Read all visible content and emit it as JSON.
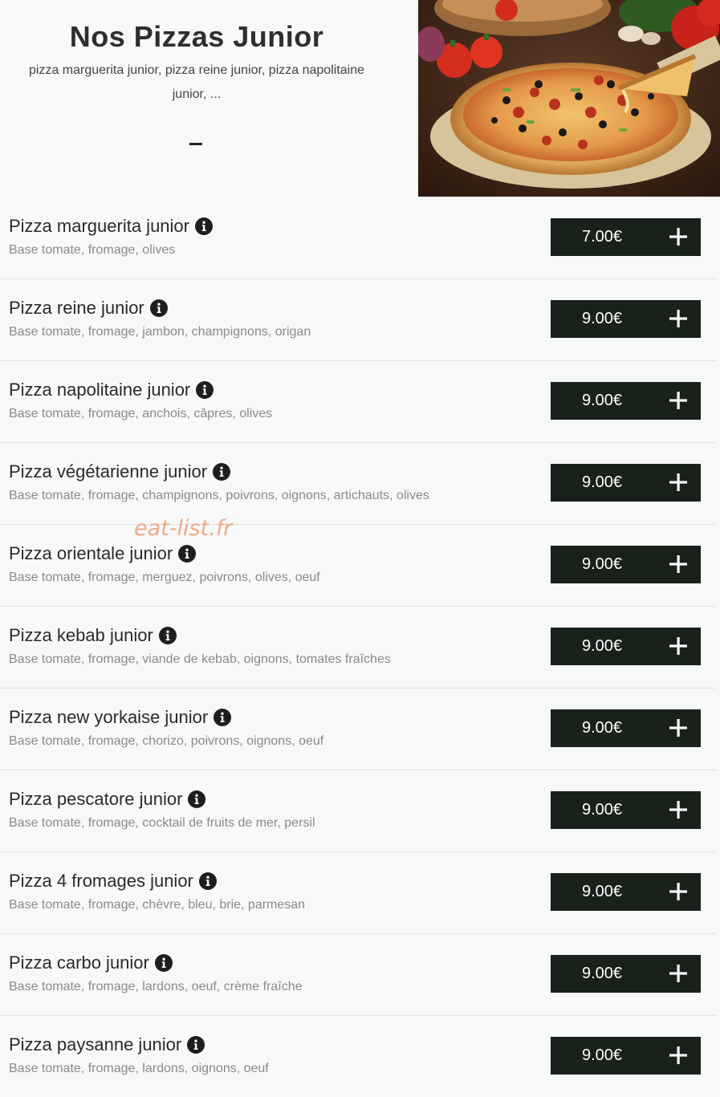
{
  "header": {
    "title": "Nos Pizzas Junior",
    "subtitle": "pizza marguerita junior, pizza reine junior, pizza napolitaine junior, ...",
    "dash": "–"
  },
  "watermark": "eat-list.fr",
  "icons": {
    "info": "info-circle-icon",
    "add": "plus-icon"
  },
  "colors": {
    "button_bg": "#18211a",
    "background": "#f7f8f9",
    "watermark": "#f0a987"
  },
  "items": [
    {
      "name": "Pizza marguerita junior",
      "description": "Base tomate, fromage, olives",
      "price": "7.00€"
    },
    {
      "name": "Pizza reine junior",
      "description": "Base tomate, fromage, jambon, champignons, origan",
      "price": "9.00€"
    },
    {
      "name": "Pizza napolitaine junior",
      "description": "Base tomate, fromage, anchois, câpres, olives",
      "price": "9.00€"
    },
    {
      "name": "Pizza végétarienne junior",
      "description": "Base tomate, fromage, champignons, poivrons, oignons, artichauts, olives",
      "price": "9.00€"
    },
    {
      "name": "Pizza orientale junior",
      "description": "Base tomate, fromage, merguez, poivrons, olives, oeuf",
      "price": "9.00€"
    },
    {
      "name": "Pizza kebab junior",
      "description": "Base tomate, fromage, viande de kebab, oignons, tomates fraîches",
      "price": "9.00€"
    },
    {
      "name": "Pizza new yorkaise junior",
      "description": "Base tomate, fromage, chorizo, poivrons, oignons, oeuf",
      "price": "9.00€"
    },
    {
      "name": "Pizza pescatore junior",
      "description": "Base tomate, fromage, cocktail de fruits de mer, persil",
      "price": "9.00€"
    },
    {
      "name": "Pizza 4 fromages junior",
      "description": "Base tomate, fromage, chèvre, bleu, brie, parmesan",
      "price": "9.00€"
    },
    {
      "name": "Pizza carbo junior",
      "description": "Base tomate, fromage, lardons, oeuf, crème fraîche",
      "price": "9.00€"
    },
    {
      "name": "Pizza paysanne junior",
      "description": "Base tomate, fromage, lardons, oignons, oeuf",
      "price": "9.00€"
    }
  ]
}
